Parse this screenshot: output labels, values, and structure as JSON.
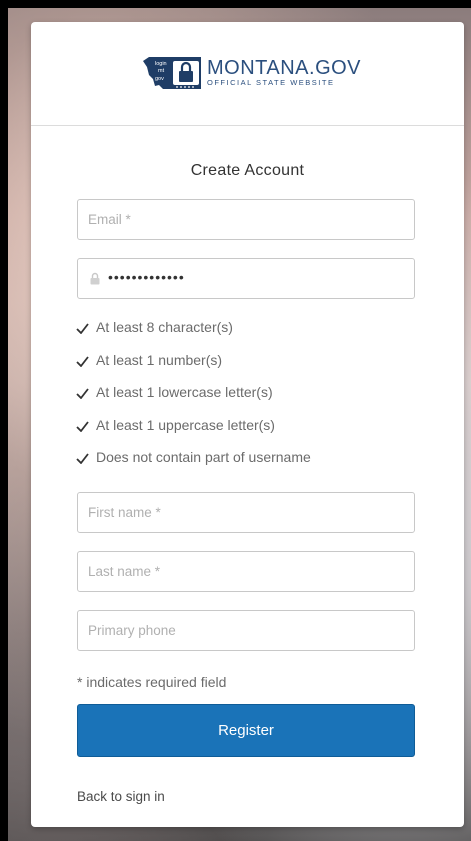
{
  "brand": {
    "mark_text": [
      "login",
      "mt",
      "gov"
    ],
    "title": "MONTANA.GOV",
    "subtitle": "OFFICIAL STATE WEBSITE",
    "color": "#2b4f7e"
  },
  "form": {
    "title": "Create Account",
    "email_placeholder": "Email *",
    "password_masked": "•••••••••••••",
    "requirements": [
      "At least 8 character(s)",
      "At least 1 number(s)",
      "At least 1 lowercase letter(s)",
      "At least 1 uppercase letter(s)",
      "Does not contain part of username"
    ],
    "first_name_placeholder": "First name *",
    "last_name_placeholder": "Last name *",
    "phone_placeholder": "Primary phone",
    "required_note": "* indicates required field",
    "register_label": "Register",
    "back_link": "Back to sign in"
  },
  "colors": {
    "accent": "#1a73b8",
    "check": "#333333"
  },
  "icons": {
    "lock": "lock-icon",
    "check": "checkmark-icon"
  }
}
